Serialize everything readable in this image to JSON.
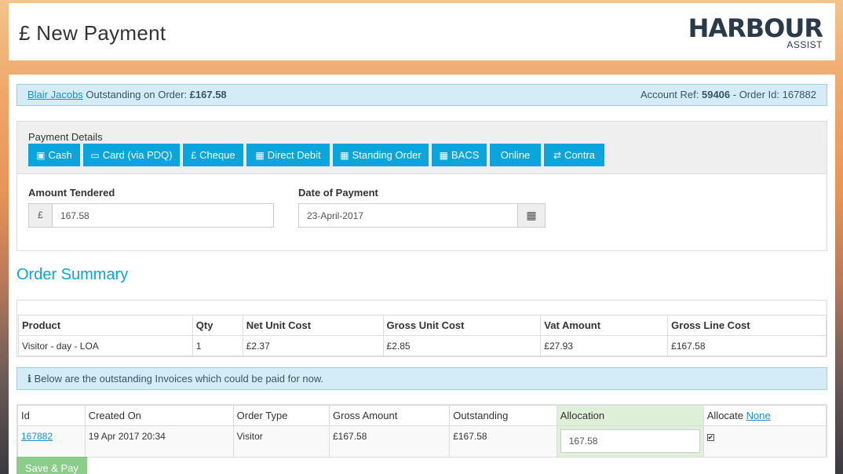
{
  "header": {
    "title": "£ New Payment",
    "logo_main": "HARBOUR",
    "logo_sub": "ASSIST"
  },
  "info_bar": {
    "customer_name": "Blair Jacobs",
    "outstanding_label": " Outstanding on Order: ",
    "outstanding_value": "£167.58",
    "account_ref_label": "Account Ref: ",
    "account_ref_value": "59406",
    "order_id_label": " - Order Id: ",
    "order_id_value": "167882"
  },
  "payment_details": {
    "label": "Payment Details",
    "methods": [
      {
        "label": "Cash",
        "icon": "money-icon",
        "glyph": "▣"
      },
      {
        "label": "Card (via PDQ)",
        "icon": "credit-card-icon",
        "glyph": "▭"
      },
      {
        "label": "Cheque",
        "icon": "pound-icon",
        "glyph": "£"
      },
      {
        "label": "Direct Debit",
        "icon": "calendar-icon",
        "glyph": "▦"
      },
      {
        "label": "Standing Order",
        "icon": "calendar-icon",
        "glyph": "▦"
      },
      {
        "label": "BACS",
        "icon": "calendar-icon",
        "glyph": "▦"
      },
      {
        "label": "Online",
        "icon": "",
        "glyph": ""
      },
      {
        "label": "Contra",
        "icon": "exchange-icon",
        "glyph": "⇄"
      }
    ],
    "amount_label": "Amount Tendered",
    "currency_symbol": "£",
    "amount_value": "167.58",
    "date_label": "Date of Payment",
    "date_value": "23-April-2017",
    "calendar_glyph": "▦"
  },
  "order_summary": {
    "title": "Order Summary",
    "columns": [
      "Product",
      "Qty",
      "Net Unit Cost",
      "Gross Unit Cost",
      "Vat Amount",
      "Gross Line Cost"
    ],
    "rows": [
      [
        "Visitor - day - LOA",
        "1",
        "£2.37",
        "£2.85",
        "£27.93",
        "£167.58"
      ]
    ]
  },
  "alert": {
    "icon_glyph": "ℹ",
    "text": "Below are the outstanding Invoices which could be paid for now."
  },
  "invoices": {
    "columns": [
      "Id",
      "Created On",
      "Order Type",
      "Gross Amount",
      "Outstanding",
      "Allocation"
    ],
    "allocate_label": "Allocate ",
    "allocate_link": "None",
    "rows": [
      {
        "id": "167882",
        "created_on": "19 Apr 2017 20:34",
        "order_type": "Visitor",
        "gross_amount": "£167.58",
        "outstanding": "£167.58",
        "allocation": "167.58",
        "checked": "✔"
      }
    ]
  },
  "save_button": "Save & Pay"
}
